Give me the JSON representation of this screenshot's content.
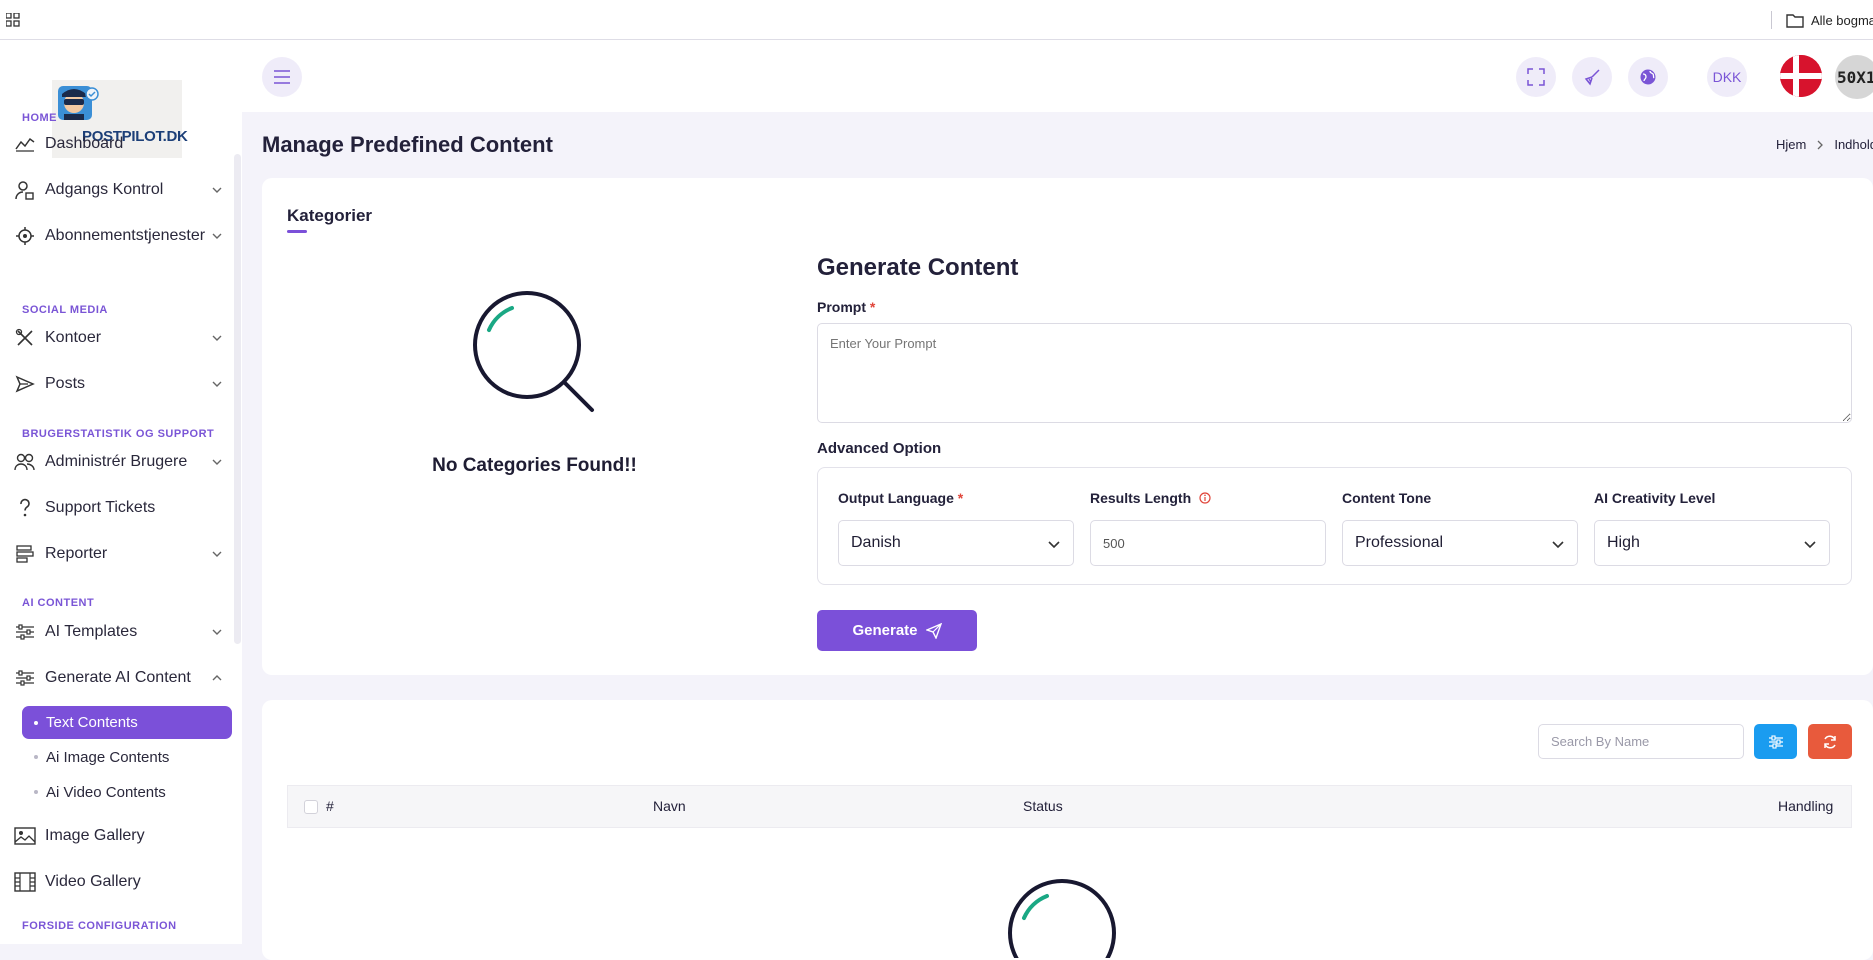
{
  "bookmarks": {
    "folder_label": "Alle bogmærker"
  },
  "brand": {
    "logo_text": "POSTPILOT.DK"
  },
  "sidebar": {
    "sections": {
      "home": "HOME",
      "social": "SOCIAL MEDIA",
      "stats": "BRUGERSTATISTIK OG SUPPORT",
      "ai": "AI CONTENT",
      "forside": "FORSIDE CONFIGURATION"
    },
    "items": {
      "dashboard": "Dashboard",
      "adgangs": "Adgangs Kontrol",
      "abonnement": "Abonnementstjenester",
      "kontoer": "Kontoer",
      "posts": "Posts",
      "brugere": "Administrér Brugere",
      "support": "Support Tickets",
      "reporter": "Reporter",
      "ai_templates": "AI Templates",
      "gen_ai": "Generate AI Content",
      "image_gallery": "Image Gallery",
      "video_gallery": "Video Gallery"
    },
    "sub_items": {
      "text": "Text Contents",
      "image": "Ai Image Contents",
      "video": "Ai Video Contents"
    }
  },
  "header": {
    "currency": "DKK",
    "avatar_text": "50X1"
  },
  "page": {
    "title": "Manage Predefined Content",
    "breadcrumb": [
      "Hjem",
      "Indhold"
    ]
  },
  "categories": {
    "tab_label": "Kategorier",
    "empty_text": "No Categories Found!!"
  },
  "generate": {
    "title": "Generate Content",
    "prompt_label": "Prompt",
    "prompt_placeholder": "Enter Your Prompt",
    "advanced_label": "Advanced Option",
    "output_language_label": "Output Language",
    "output_language_value": "Danish",
    "results_length_label": "Results Length",
    "results_length_value": "500",
    "content_tone_label": "Content Tone",
    "content_tone_value": "Professional",
    "creativity_label": "AI Creativity Level",
    "creativity_value": "High",
    "button_label": "Generate"
  },
  "table": {
    "search_placeholder": "Search By Name",
    "columns": [
      "#",
      "Navn",
      "Status",
      "Handling"
    ]
  },
  "colors": {
    "accent": "#7b50d9",
    "filter_button": "#1a9cf0",
    "refresh_button": "#e85a3c"
  }
}
